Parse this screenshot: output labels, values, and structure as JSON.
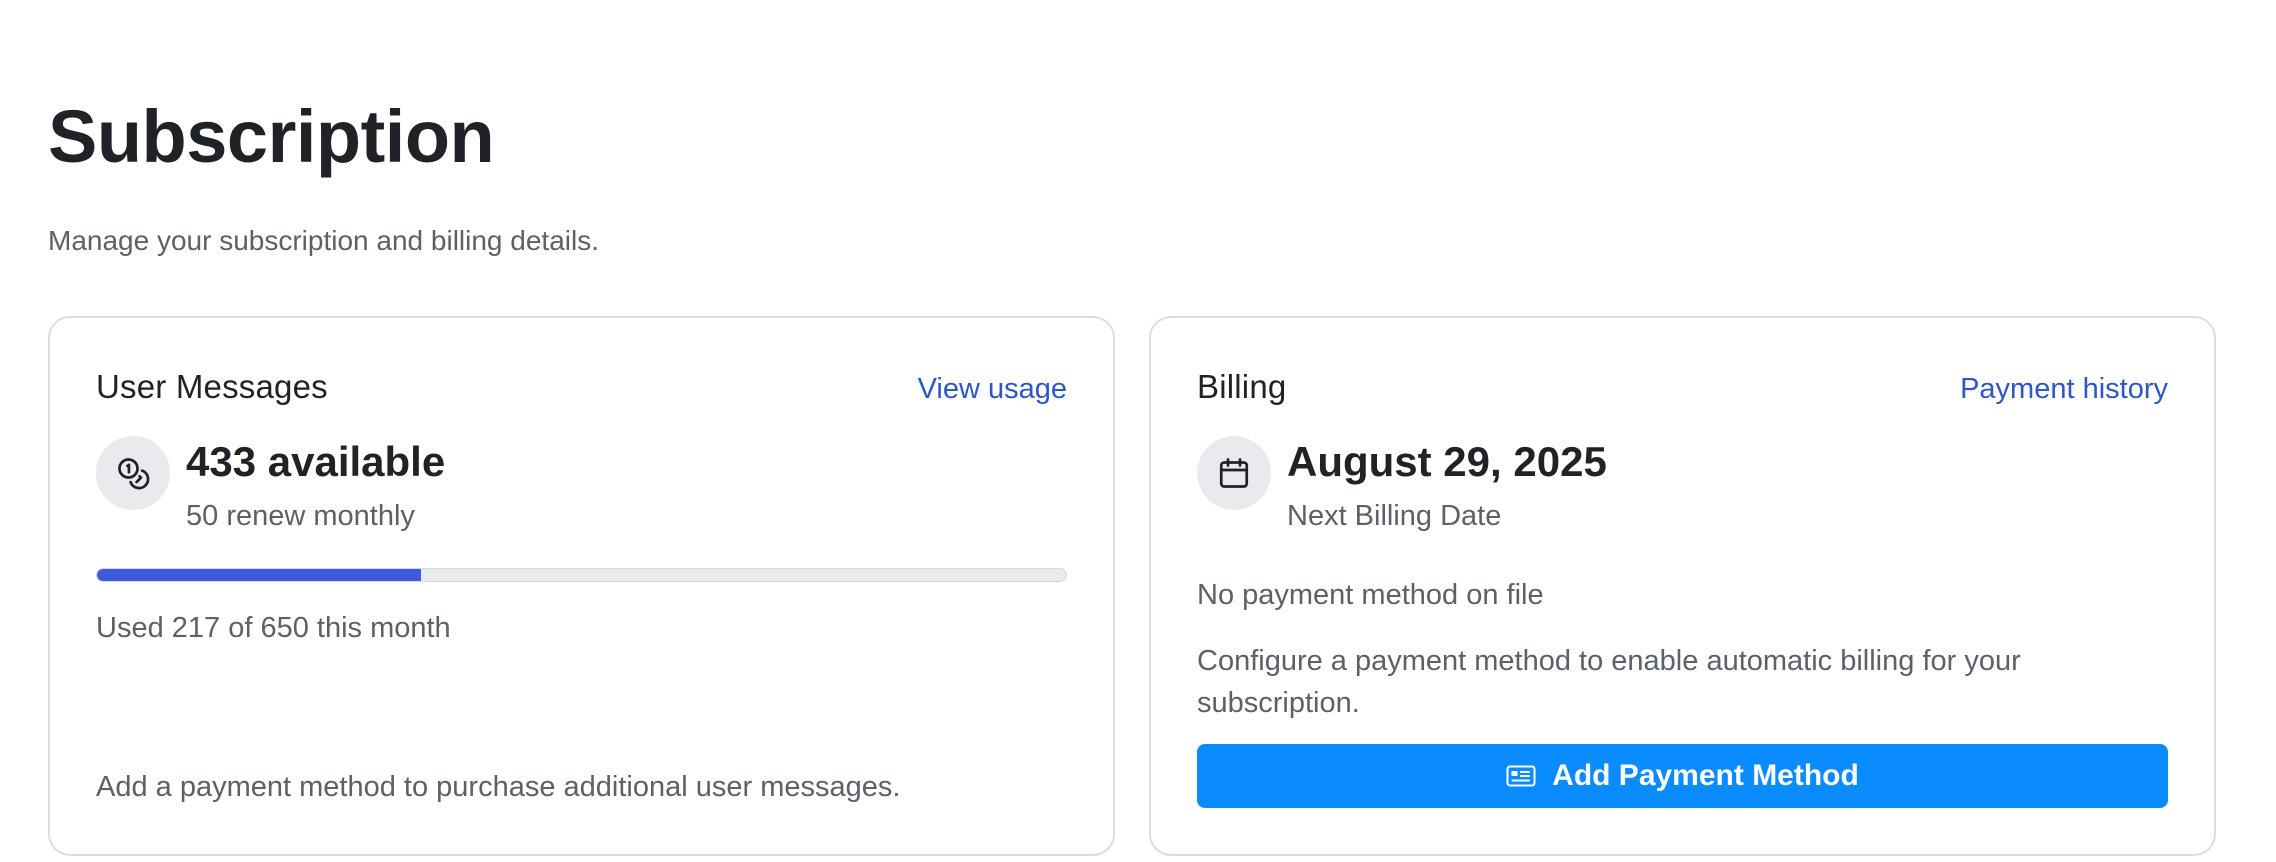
{
  "page": {
    "title": "Subscription",
    "subtitle": "Manage your subscription and billing details."
  },
  "messages_card": {
    "title": "User Messages",
    "link_label": "View usage",
    "icon": "coins-icon",
    "available": "433 available",
    "renew": "50 renew monthly",
    "used": 217,
    "total": 650,
    "usage_fraction": 0.334,
    "usage_text": "Used 217 of 650 this month",
    "footer_note": "Add a payment method to purchase additional user messages."
  },
  "billing_card": {
    "title": "Billing",
    "link_label": "Payment history",
    "icon": "calendar-icon",
    "next_date": "August 29, 2025",
    "next_date_label": "Next Billing Date",
    "payment_status": "No payment method on file",
    "payment_hint": "Configure a payment method to enable automatic billing for your subscription.",
    "button_label": "Add Payment Method",
    "button_icon": "credit-card-icon"
  },
  "colors": {
    "accent_link": "#2f57c4",
    "progress_fill": "#3b5bdb",
    "primary_button": "#0a8cff"
  }
}
